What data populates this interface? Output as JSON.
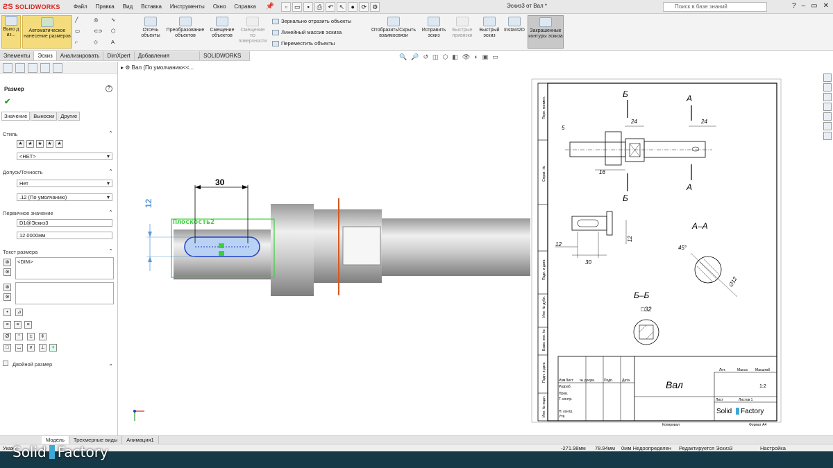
{
  "app": {
    "brand": "SOLIDWORKS",
    "window_title": "Эскиз3 от Вал *",
    "search_placeholder": "Поиск в базе знаний"
  },
  "menu": [
    "Файл",
    "Правка",
    "Вид",
    "Вставка",
    "Инструменты",
    "Окно",
    "Справка"
  ],
  "ribbon": {
    "exit_sketch": "Выхо д из...",
    "smart_dimension": "Автоматическое нанесение размеров",
    "trim": "Отсечь объекты",
    "convert": "Преобразование объектов",
    "offset": "Смещение объектов",
    "offset_surface": "Смещение по поверхности",
    "mirror": "Зеркально отразить объекты",
    "linear_pattern": "Линейный массив эскиза",
    "move": "Переместить объекты",
    "display_relations": "Отобразить/Скрыть взаимосвязи",
    "repair": "Исправить эскиз",
    "quick_snaps": "Быстрые привязки",
    "rapid_sketch": "Быстрый эскиз",
    "instant2d": "Instant2D",
    "shaded_contours": "Закрашенные контуры эскиза"
  },
  "cm_tabs": [
    "Элементы",
    "Эскиз",
    "Анализировать",
    "DimXpert",
    "Добавления SOLIDWORKS",
    "SOLIDWORKS MBD"
  ],
  "panel": {
    "title": "Размер",
    "subtabs": [
      "Значение",
      "Выноски",
      "Другие"
    ],
    "style_label": "Стиль",
    "style_value": "<НЕТ>",
    "tolerance_label": "Допуск/Точность",
    "tolerance_value": "Нет",
    "precision_value": ".12 (По умолчанию)",
    "primary_label": "Первичное значение",
    "dim_name": "D1@Эскиз3",
    "dim_value": "12.0000мм",
    "dim_text_label": "Текст размера",
    "dim_text": "<DIM>",
    "dual_label": "Двойной размер"
  },
  "tree": "Вал (По умолчанию<<...",
  "model": {
    "dim_30": "30",
    "dim_12": "12",
    "plane": "Плоскость2"
  },
  "drawing": {
    "b": "Б",
    "a": "А",
    "d5": "5",
    "d24a": "24",
    "d24b": "24",
    "d16": "16",
    "d12a": "12",
    "d12b": "12",
    "d30": "30",
    "aa": "А–А",
    "bb": "Б–Б",
    "ang": "45°",
    "phi12": "∅12",
    "sq32": "□32",
    "title": "Вал",
    "scale": "1:2",
    "lit": "Лит.",
    "mass": "Масса",
    "masstab": "Масштаб",
    "list": "Лист",
    "listov": "Листов 1",
    "copy": "Копировал",
    "format": "Формат А4",
    "izm": "Изм",
    "list2": "Лист",
    "ndoc": "№ докум.",
    "podp": "Подп.",
    "data": "Дата",
    "razrab": "Разраб.",
    "prov": "Пров.",
    "tkontr": "Т. контр.",
    "nkontr": "Н. контр.",
    "utv": "Утв.",
    "side1": "Перв. примен.",
    "side2": "Справ. №",
    "side3": "Подп. и дата",
    "side4": "Инв. № дубл.",
    "side5": "Взам. инв. №",
    "side6": "Подп. и дата",
    "side7": "Инв. № подл.",
    "sf1": "Solid",
    "sf2": "Factory"
  },
  "bottom_tabs": [
    "Модель",
    "Трехмерные виды",
    "Анимация1"
  ],
  "status": {
    "label": "Укаж",
    "x": "-271.98мм",
    "y": "78.94мм",
    "z": "0мм Недоопределен",
    "edit": "Редактируется Эскиз3",
    "custom": "Настройка"
  },
  "watermark": {
    "left": "Solid",
    "right": "Factory"
  }
}
